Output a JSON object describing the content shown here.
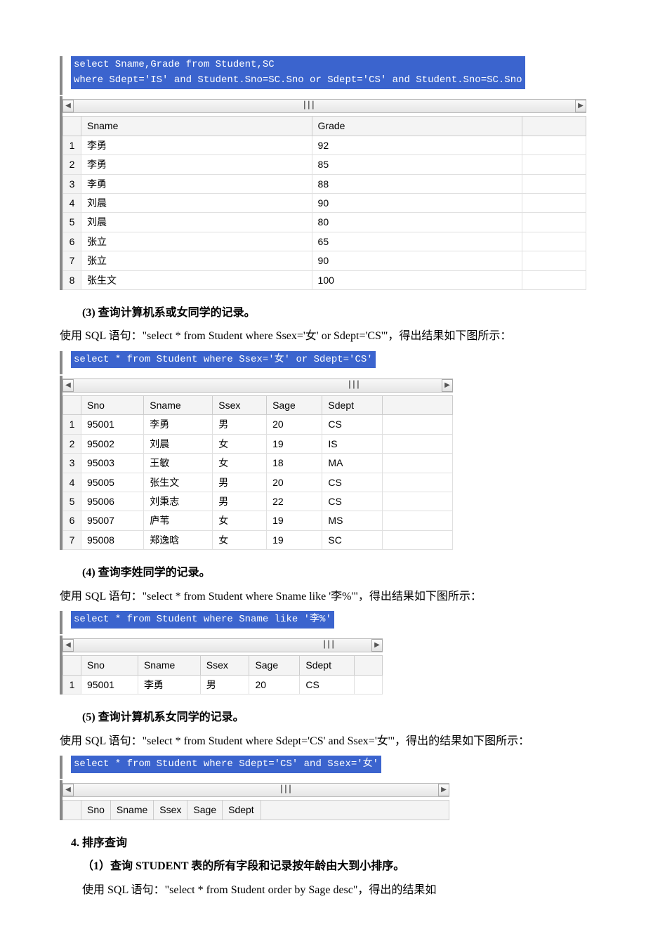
{
  "scroll_thumb": "┃┃┃",
  "sections": {
    "s1": {
      "sql": "select Sname,Grade from Student,SC\nwhere Sdept='IS' and Student.Sno=SC.Sno or Sdept='CS' and Student.Sno=SC.Sno",
      "cols": {
        "c1": "Sname",
        "c2": "Grade"
      },
      "rows": [
        {
          "i": "1",
          "sname": "李勇",
          "grade": "92"
        },
        {
          "i": "2",
          "sname": "李勇",
          "grade": "85"
        },
        {
          "i": "3",
          "sname": "李勇",
          "grade": "88"
        },
        {
          "i": "4",
          "sname": "刘晨",
          "grade": "90"
        },
        {
          "i": "5",
          "sname": "刘晨",
          "grade": "80"
        },
        {
          "i": "6",
          "sname": "张立",
          "grade": "65"
        },
        {
          "i": "7",
          "sname": "张立",
          "grade": "90"
        },
        {
          "i": "8",
          "sname": "张生文",
          "grade": "100"
        }
      ]
    },
    "s3": {
      "title": "(3) 查询计算机系或女同学的记录。",
      "para_prefix": "使用 SQL 语句：\"",
      "para_sql": "select * from Student where Ssex='女' or Sdept='CS'",
      "para_suffix": "\"，得出结果如下图所示：",
      "sql": "select * from Student where Ssex='女' or Sdept='CS'",
      "cols": {
        "c1": "Sno",
        "c2": "Sname",
        "c3": "Ssex",
        "c4": "Sage",
        "c5": "Sdept"
      },
      "rows": [
        {
          "i": "1",
          "sno": "95001",
          "sname": "李勇",
          "ssex": "男",
          "sage": "20",
          "sdept": "CS"
        },
        {
          "i": "2",
          "sno": "95002",
          "sname": "刘晨",
          "ssex": "女",
          "sage": "19",
          "sdept": "IS"
        },
        {
          "i": "3",
          "sno": "95003",
          "sname": "王敏",
          "ssex": "女",
          "sage": "18",
          "sdept": "MA"
        },
        {
          "i": "4",
          "sno": "95005",
          "sname": "张生文",
          "ssex": "男",
          "sage": "20",
          "sdept": "CS"
        },
        {
          "i": "5",
          "sno": "95006",
          "sname": "刘秉志",
          "ssex": "男",
          "sage": "22",
          "sdept": "CS"
        },
        {
          "i": "6",
          "sno": "95007",
          "sname": "庐苇",
          "ssex": "女",
          "sage": "19",
          "sdept": "MS"
        },
        {
          "i": "7",
          "sno": "95008",
          "sname": "郑逸晗",
          "ssex": "女",
          "sage": "19",
          "sdept": "SC"
        }
      ]
    },
    "s4": {
      "title": "(4) 查询李姓同学的记录。",
      "para_prefix": "使用 SQL 语句：\"",
      "para_sql": "select * from Student where Sname like '李%'",
      "para_suffix": "\"，得出结果如下图所示：",
      "sql": "select * from Student where Sname like '李%'",
      "cols": {
        "c1": "Sno",
        "c2": "Sname",
        "c3": "Ssex",
        "c4": "Sage",
        "c5": "Sdept"
      },
      "rows": [
        {
          "i": "1",
          "sno": "95001",
          "sname": "李勇",
          "ssex": "男",
          "sage": "20",
          "sdept": "CS"
        }
      ]
    },
    "s5": {
      "title": "(5) 查询计算机系女同学的记录。",
      "para_prefix": "使用 SQL 语句：\"",
      "para_sql": "select * from Student where Sdept='CS' and Ssex='女'",
      "para_suffix": "\"，得出的结果如下图所示：",
      "sql": "select * from Student where Sdept='CS' and Ssex='女'",
      "cols": {
        "c1": "Sno",
        "c2": "Sname",
        "c3": "Ssex",
        "c4": "Sage",
        "c5": "Sdept"
      }
    },
    "sort": {
      "heading": "4. 排序查询",
      "sub1_title": "（1）查询 STUDENT 表的所有字段和记录按年龄由大到小排序。",
      "sub1_para_prefix": "使用 SQL 语句：\"",
      "sub1_para_sql": "select * from Student order by Sage desc",
      "sub1_para_suffix": "\"，得出的结果如"
    }
  }
}
